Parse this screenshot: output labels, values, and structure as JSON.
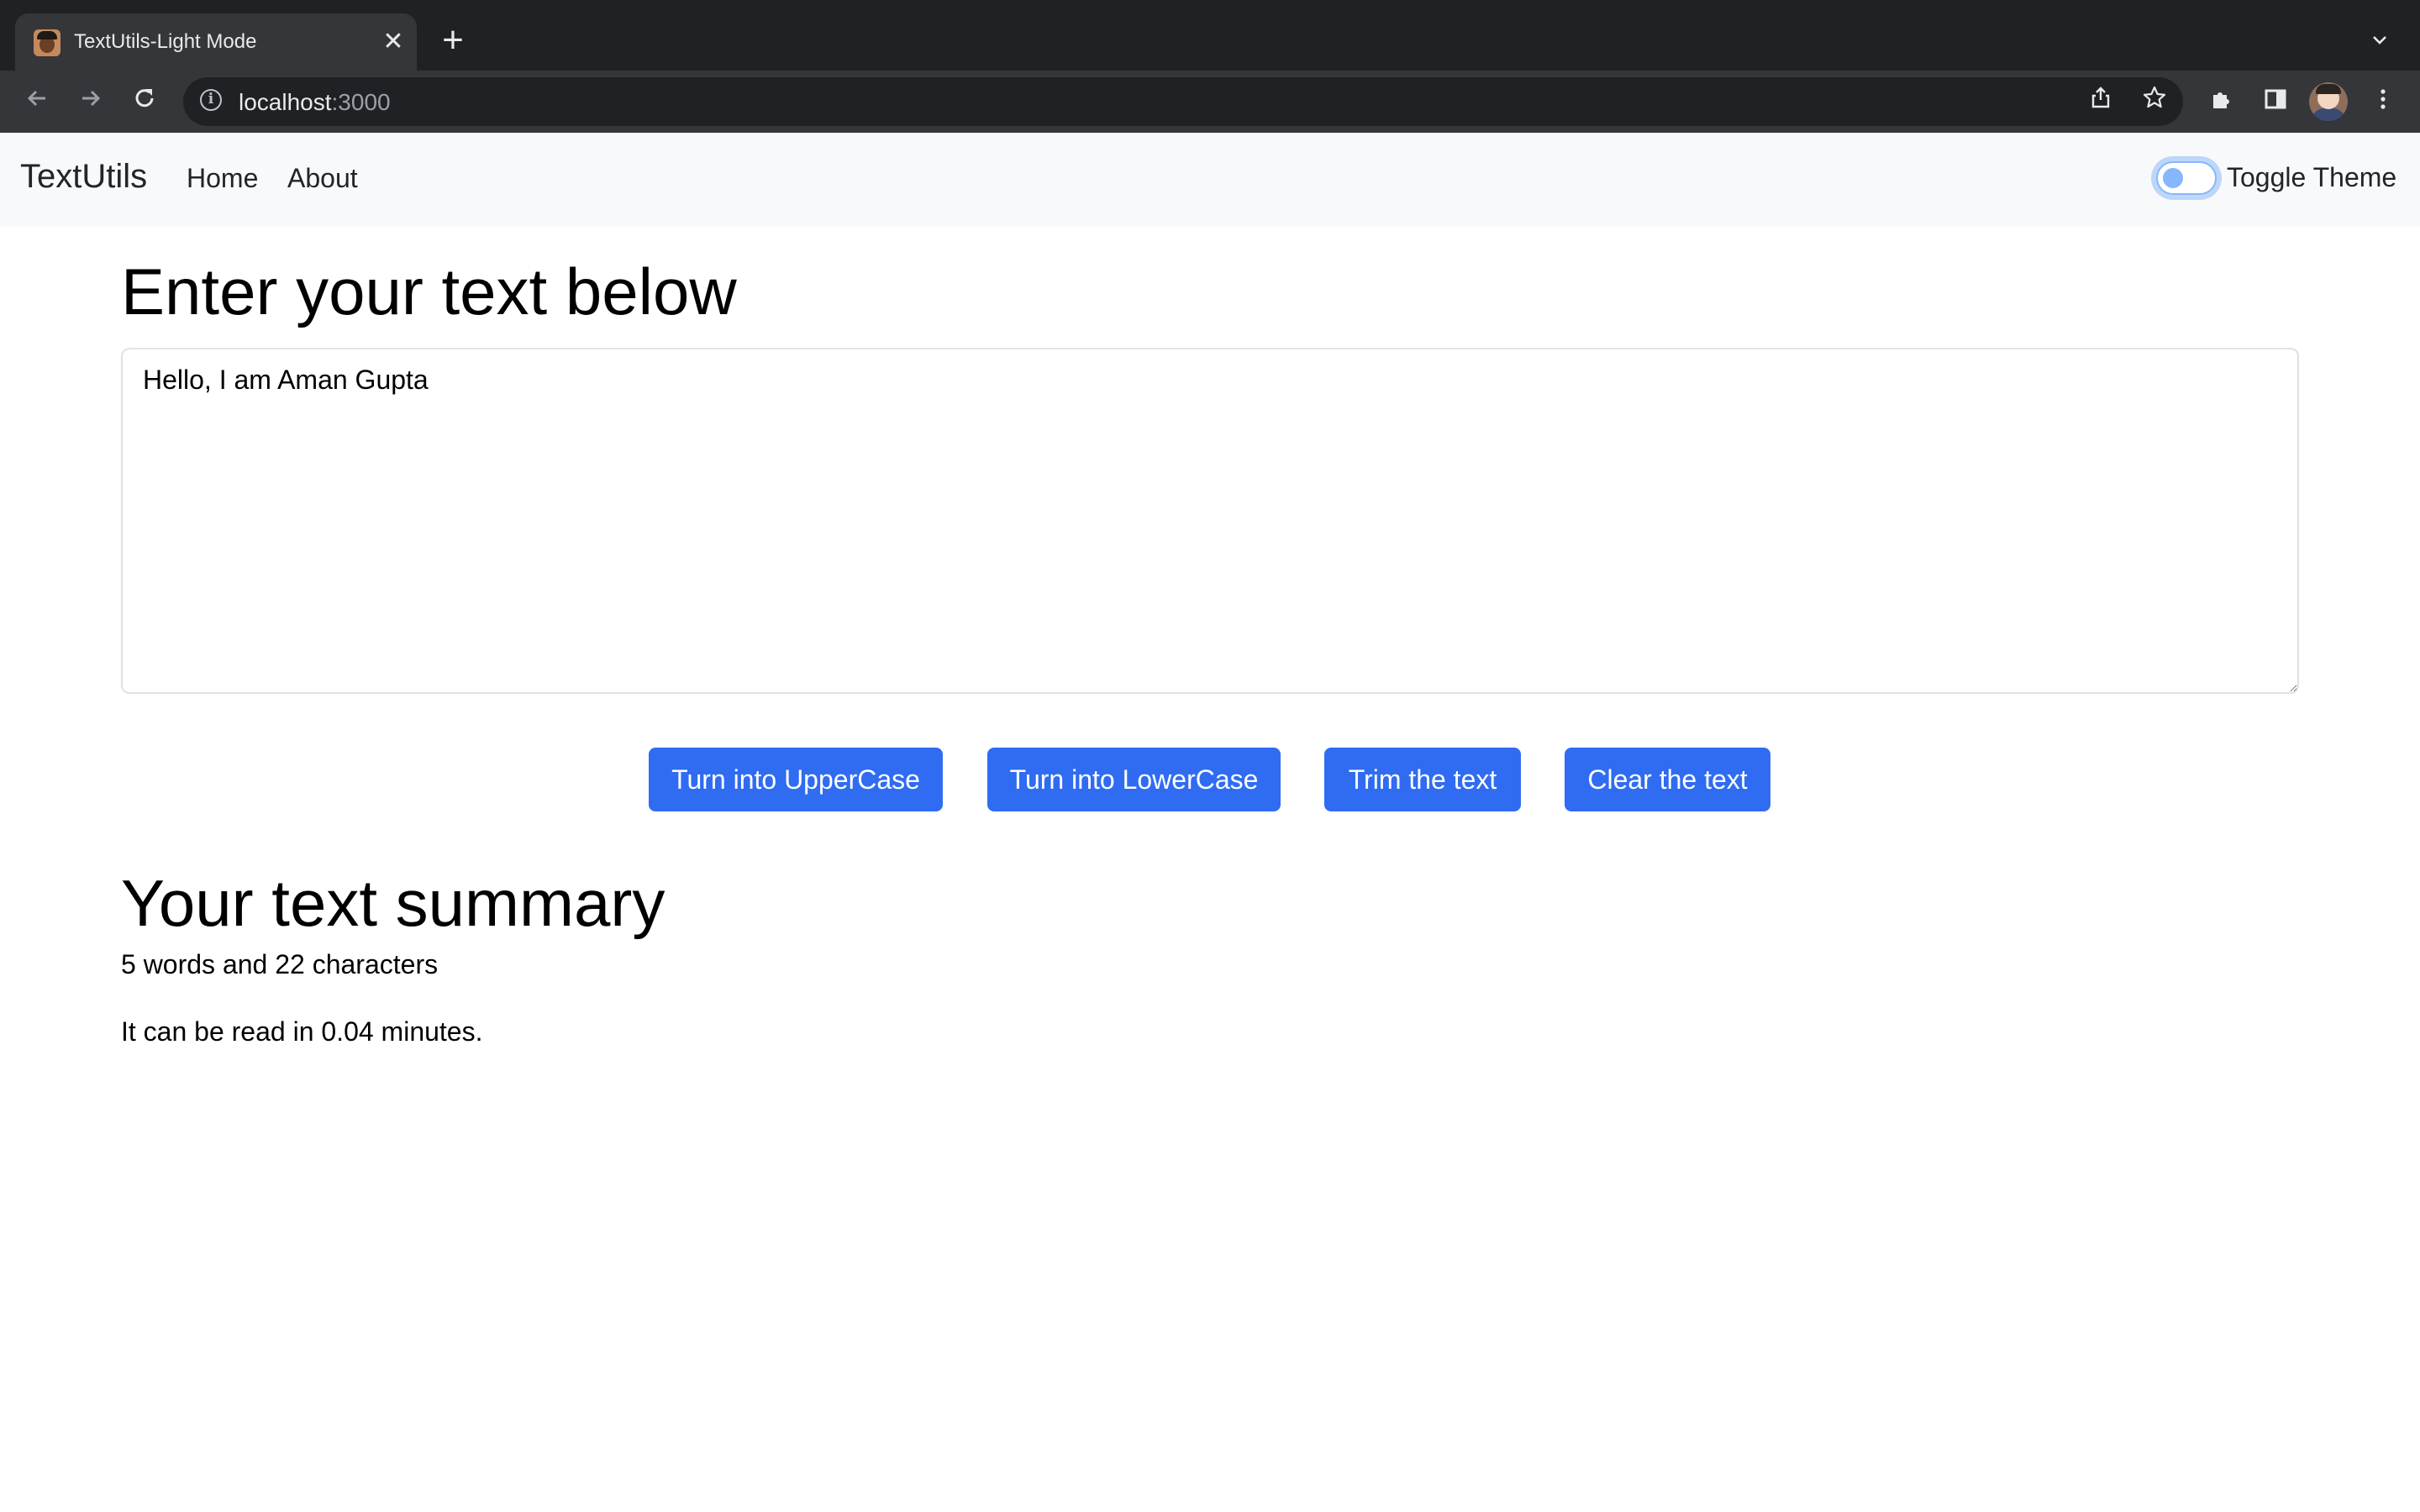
{
  "browser": {
    "tab_title": "TextUtils-Light Mode",
    "url_host": "localhost",
    "url_port": ":3000"
  },
  "navbar": {
    "brand": "TextUtils",
    "links": [
      "Home",
      "About"
    ],
    "toggle_label": "Toggle Theme",
    "toggle_on": false
  },
  "main": {
    "heading": "Enter your text below",
    "text_value": "Hello, I am Aman Gupta",
    "buttons": [
      "Turn into UpperCase",
      "Turn into LowerCase",
      "Trim the text",
      "Clear the text"
    ]
  },
  "summary": {
    "heading": "Your text summary",
    "counts": "5 words and 22 characters",
    "read_time": "It can be read in 0.04 minutes."
  },
  "colors": {
    "primary_button": "#2f6cf2",
    "navbar_bg": "#f8f9fa",
    "chrome_dark": "#202124"
  }
}
